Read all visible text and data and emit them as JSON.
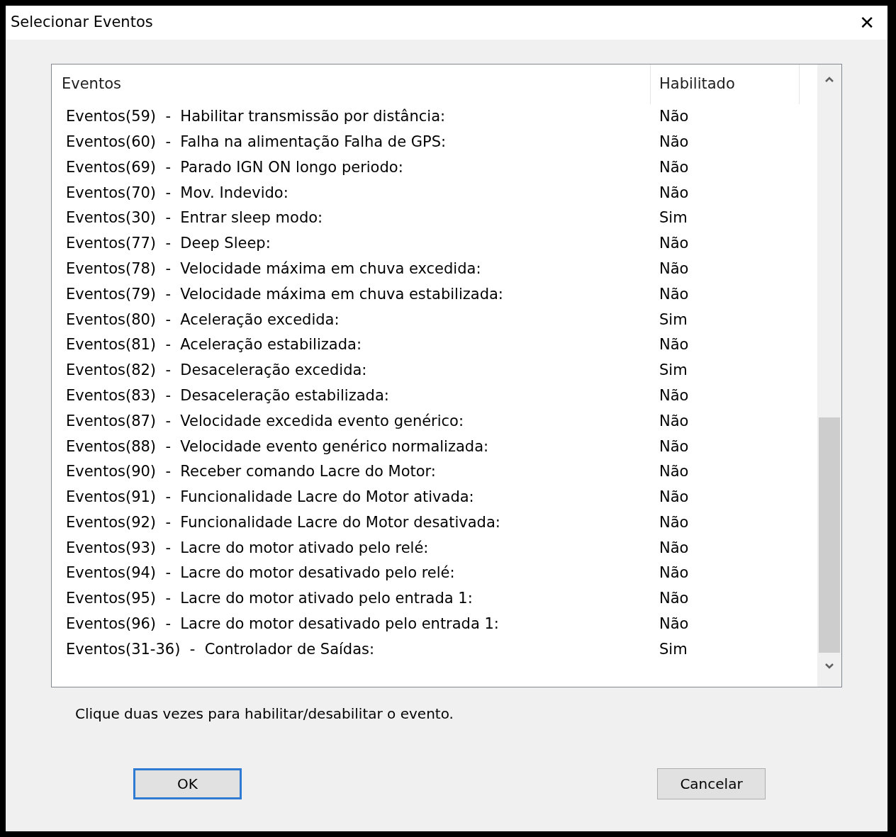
{
  "window": {
    "title": "Selecionar Eventos",
    "close": "✕"
  },
  "table": {
    "columns": [
      "Eventos",
      "Habilitado"
    ],
    "rows": [
      {
        "event": "Eventos(59)  -  Habilitar transmissão por distância:",
        "enabled": "Não"
      },
      {
        "event": "Eventos(60)  -  Falha na alimentação Falha de GPS:",
        "enabled": "Não"
      },
      {
        "event": "Eventos(69)  -  Parado IGN ON longo periodo:",
        "enabled": "Não"
      },
      {
        "event": "Eventos(70)  -  Mov. Indevido:",
        "enabled": "Não"
      },
      {
        "event": "Eventos(30)  -  Entrar sleep modo:",
        "enabled": "Sim"
      },
      {
        "event": "Eventos(77)  -  Deep Sleep:",
        "enabled": "Não"
      },
      {
        "event": "Eventos(78)  -  Velocidade máxima em chuva excedida:",
        "enabled": "Não"
      },
      {
        "event": "Eventos(79)  -  Velocidade máxima em chuva estabilizada:",
        "enabled": "Não"
      },
      {
        "event": "Eventos(80)  -  Aceleração excedida:",
        "enabled": "Sim"
      },
      {
        "event": "Eventos(81)  -  Aceleração estabilizada:",
        "enabled": "Não"
      },
      {
        "event": "Eventos(82)  -  Desaceleração excedida:",
        "enabled": "Sim"
      },
      {
        "event": "Eventos(83)  -  Desaceleração estabilizada:",
        "enabled": "Não"
      },
      {
        "event": "Eventos(87)  -  Velocidade excedida evento genérico:",
        "enabled": "Não"
      },
      {
        "event": "Eventos(88)  -  Velocidade evento genérico normalizada:",
        "enabled": "Não"
      },
      {
        "event": "Eventos(90)  -  Receber comando Lacre do Motor:",
        "enabled": "Não"
      },
      {
        "event": "Eventos(91)  -  Funcionalidade Lacre do Motor ativada:",
        "enabled": "Não"
      },
      {
        "event": "Eventos(92)  -  Funcionalidade Lacre do Motor desativada:",
        "enabled": "Não"
      },
      {
        "event": "Eventos(93)  -  Lacre do motor ativado pelo relé:",
        "enabled": "Não"
      },
      {
        "event": "Eventos(94)  -  Lacre do motor desativado pelo relé:",
        "enabled": "Não"
      },
      {
        "event": "Eventos(95)  -  Lacre do motor ativado pelo entrada 1:",
        "enabled": "Não"
      },
      {
        "event": "Eventos(96)  -  Lacre do motor desativado pelo entrada 1:",
        "enabled": "Não"
      },
      {
        "event": "Eventos(31-36)  -  Controlador de Saídas:",
        "enabled": "Sim"
      }
    ]
  },
  "hint": "Clique duas vezes para habilitar/desabilitar o evento.",
  "buttons": [
    {
      "label": "OK",
      "focused": true
    },
    {
      "label": "Cancelar",
      "focused": false
    }
  ]
}
